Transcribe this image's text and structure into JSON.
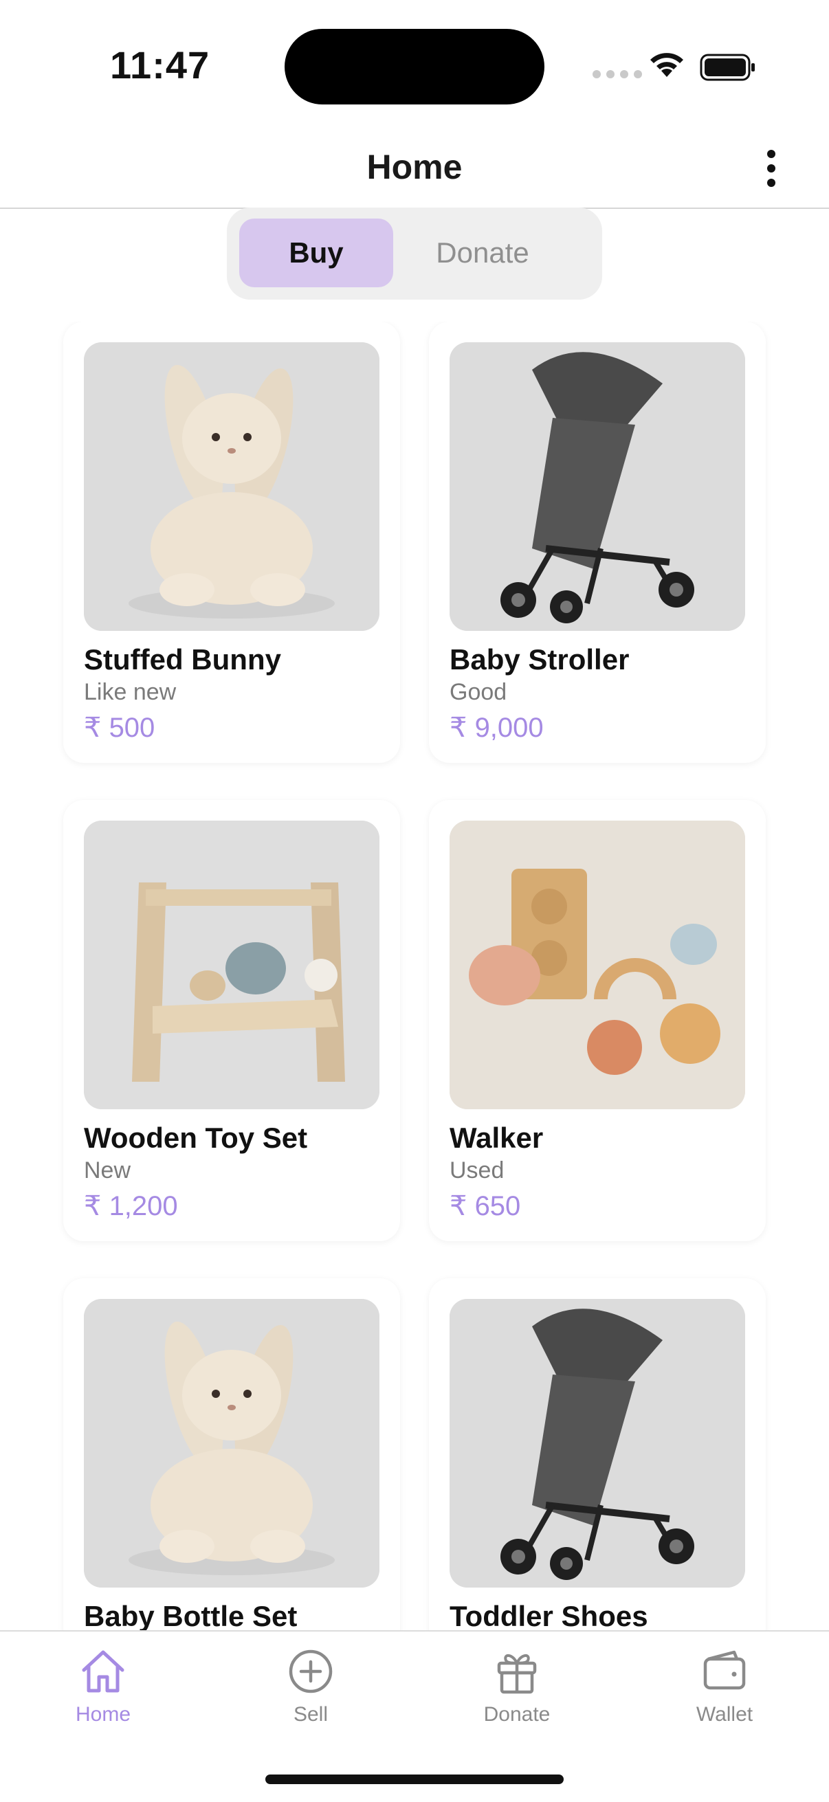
{
  "status_bar": {
    "time": "11:47"
  },
  "header": {
    "title": "Home",
    "more_icon": "more-vertical-icon"
  },
  "segment": {
    "options": [
      "Buy",
      "Donate"
    ],
    "selected": "Buy"
  },
  "products": [
    {
      "name": "Stuffed Bunny",
      "condition": "Like new",
      "price": "₹ 500",
      "image": "stuffed-bunny"
    },
    {
      "name": "Baby Stroller",
      "condition": "Good",
      "price": "₹ 9,000",
      "image": "stroller"
    },
    {
      "name": "Wooden Toy Set",
      "condition": "New",
      "price": "₹ 1,200",
      "image": "wooden-toy"
    },
    {
      "name": "Walker",
      "condition": "Used",
      "price": "₹ 650",
      "image": "wooden-blocks"
    },
    {
      "name": "Baby Bottle Set",
      "condition": "",
      "price": "",
      "image": "stuffed-bunny"
    },
    {
      "name": "Toddler Shoes",
      "condition": "",
      "price": "",
      "image": "stroller"
    }
  ],
  "tabbar": {
    "tabs": [
      {
        "label": "Home",
        "icon": "home-icon",
        "active": true
      },
      {
        "label": "Sell",
        "icon": "plus-circle-icon",
        "active": false
      },
      {
        "label": "Donate",
        "icon": "gift-icon",
        "active": false
      },
      {
        "label": "Wallet",
        "icon": "wallet-icon",
        "active": false
      }
    ]
  },
  "colors": {
    "accent": "#a58ae3",
    "segment_active": "#d7c7ee",
    "muted": "#8a8a8a"
  }
}
